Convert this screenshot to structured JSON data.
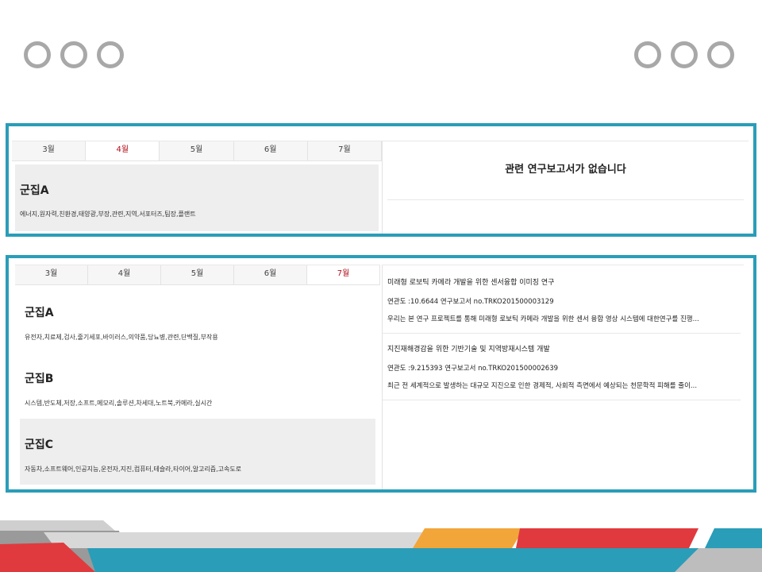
{
  "decor": {
    "circle_color": "#a8a8a8",
    "panel_border_color": "#2a9db8",
    "active_tab_color": "#b0101c"
  },
  "panel1": {
    "tabs": [
      {
        "label": "3월",
        "active": false
      },
      {
        "label": "4월",
        "active": true
      },
      {
        "label": "5월",
        "active": false
      },
      {
        "label": "6월",
        "active": false
      },
      {
        "label": "7월",
        "active": false
      }
    ],
    "clusters": [
      {
        "title": "군집A",
        "keywords": "에너지,원자력,친환경,태양광,부장,관련,지역,서포터즈,팀장,플랜트"
      }
    ],
    "no_reports_message": "관련 연구보고서가 없습니다"
  },
  "panel2": {
    "tabs": [
      {
        "label": "3월",
        "active": false
      },
      {
        "label": "4월",
        "active": false
      },
      {
        "label": "5월",
        "active": false
      },
      {
        "label": "6월",
        "active": false
      },
      {
        "label": "7월",
        "active": true
      }
    ],
    "clusters": [
      {
        "title": "군집A",
        "keywords": "유전자,치료제,검사,줄기세포,바이러스,의약품,당뇨병,관련,단백질,부작용"
      },
      {
        "title": "군집B",
        "keywords": "시스템,반도체,저장,소프트,메모리,솔루션,차세대,노트북,카메라,실시간"
      },
      {
        "title": "군집C",
        "keywords": "자동차,소프트웨어,인공지능,운전자,지진,컴퓨터,테슬라,타이어,알고리즘,고속도로"
      }
    ],
    "reports": [
      {
        "title": "미래형 로보틱 카메라 개발을 위한 센서융합 이미징 연구",
        "meta": "연관도 :10.6644 연구보고서 no.TRKO201500003129",
        "desc": "우리는 본 연구 프로젝트를 통해 미래형 로보틱 카메라 개발을 위한 센서 융합 영상 시스템에 대한연구를 진행..."
      },
      {
        "title": "지진재해경감을 위한 기반기술 및 지역방재시스템 개발",
        "meta": "연관도 :9.215393 연구보고서 no.TRKO201500002639",
        "desc": "최근 전 세계적으로 발생하는 대규모 지진으로 인한 경제적, 사회적 측면에서 예상되는 천문학적 피해를 줄이..."
      }
    ]
  }
}
